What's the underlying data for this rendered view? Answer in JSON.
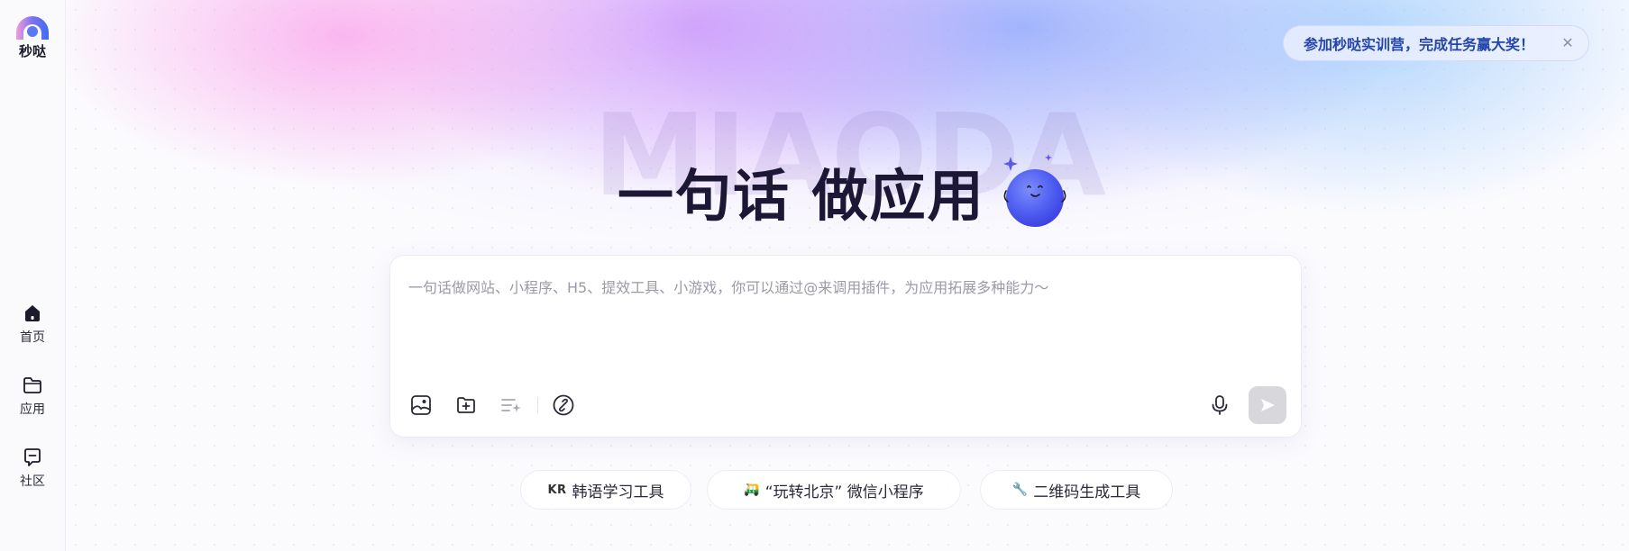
{
  "app": {
    "brand_name": "秒哒",
    "brand_colors": {
      "pink": "#f0a5e6",
      "blue": "#4f7bf2",
      "violet": "#6a5af9"
    }
  },
  "sidebar": {
    "items": [
      {
        "label": "首页",
        "icon": "home-icon",
        "active": true
      },
      {
        "label": "应用",
        "icon": "folder-icon"
      },
      {
        "label": "社区",
        "icon": "chat-icon"
      }
    ]
  },
  "promo": {
    "text": "参加秒哒实训营，完成任务赢大奖！",
    "close_icon": "close-icon"
  },
  "hero": {
    "watermark": "MIAODA",
    "title": "一句话 做应用"
  },
  "prompt": {
    "placeholder": "一句话做网站、小程序、H5、提效工具、小游戏，你可以通过@来调用插件，为应用拓展多种能力～",
    "value": ""
  },
  "toolbar": {
    "tools": [
      "image-upload-icon",
      "file-add-icon",
      "prompt-optimize-icon",
      "plugin-link-icon",
      "microphone-icon",
      "send-icon"
    ]
  },
  "suggestions": [
    {
      "icon": "KR",
      "label": "韩语学习工具"
    },
    {
      "icon": "🛺",
      "label": "“玩转北京” 微信小程序"
    },
    {
      "icon": "🔧",
      "label": "二维码生成工具"
    }
  ]
}
